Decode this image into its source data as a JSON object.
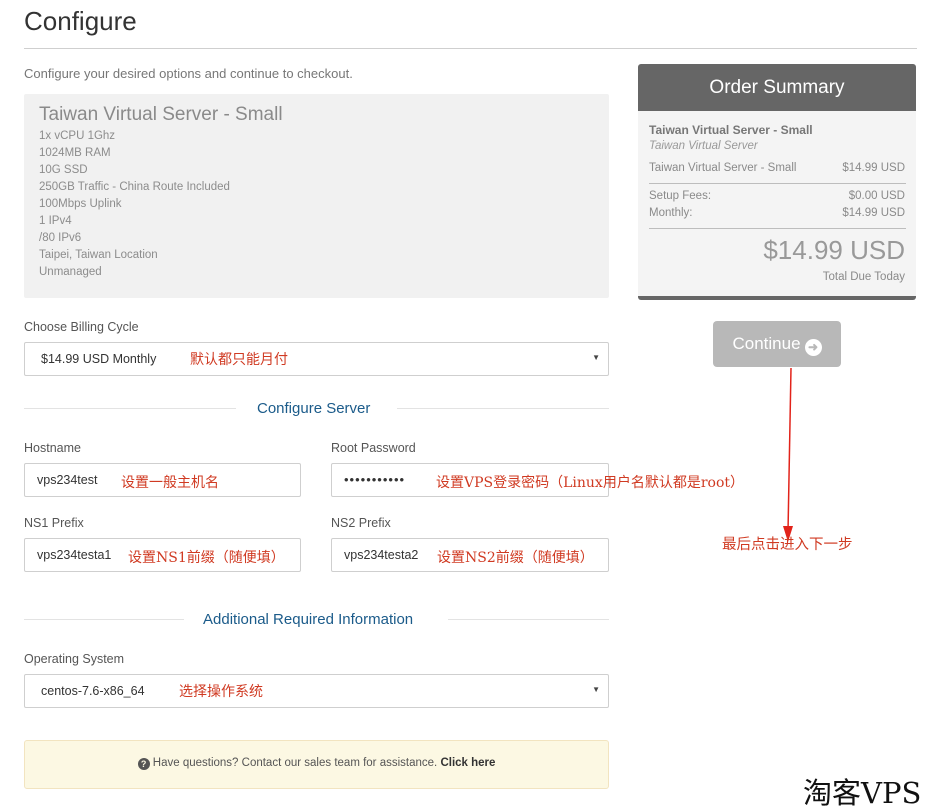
{
  "page": {
    "title": "Configure",
    "intro": "Configure your desired options and continue to checkout."
  },
  "product": {
    "name": "Taiwan Virtual Server - Small",
    "specs": [
      "1x vCPU 1Ghz",
      "1024MB RAM",
      "10G SSD",
      "250GB Traffic - China Route Included",
      "100Mbps Uplink",
      "1 IPv4",
      "/80 IPv6",
      "Taipei, Taiwan Location",
      "Unmanaged"
    ]
  },
  "billing": {
    "label": "Choose Billing Cycle",
    "value": "$14.99 USD Monthly",
    "note": "默认都只能月付"
  },
  "configure_server": {
    "heading": "Configure Server",
    "hostname": {
      "label": "Hostname",
      "value": "vps234test",
      "note": "设置一般主机名"
    },
    "root_password": {
      "label": "Root Password",
      "value": "•••••••••••",
      "note": "设置VPS登录密码（Linux用户名默认都是root）"
    },
    "ns1": {
      "label": "NS1 Prefix",
      "value": "vps234testa1",
      "note": "设置NS1前缀（随便填）"
    },
    "ns2": {
      "label": "NS2 Prefix",
      "value": "vps234testa2",
      "note": "设置NS2前缀（随便填）"
    }
  },
  "additional": {
    "heading": "Additional Required Information",
    "os": {
      "label": "Operating System",
      "value": "centos-7.6-x86_64",
      "note": "选择操作系统"
    }
  },
  "help": {
    "icon": "question-circle-icon",
    "text": "Have questions? Contact our sales team for assistance.",
    "link": "Click here"
  },
  "summary": {
    "heading": "Order Summary",
    "product_name": "Taiwan Virtual Server - Small",
    "product_group": "Taiwan Virtual Server",
    "line_item": "Taiwan Virtual Server - Small",
    "line_price": "$14.99 USD",
    "setup_label": "Setup Fees:",
    "setup_value": "$0.00 USD",
    "monthly_label": "Monthly:",
    "monthly_value": "$14.99 USD",
    "total": "$14.99 USD",
    "total_label": "Total Due Today"
  },
  "continue_button": {
    "label": "Continue",
    "icon": "arrow-circle-right-icon"
  },
  "annotation": {
    "text": "最后点击进入下一步",
    "color": "#d03a22"
  },
  "watermark": "淘客VPS"
}
